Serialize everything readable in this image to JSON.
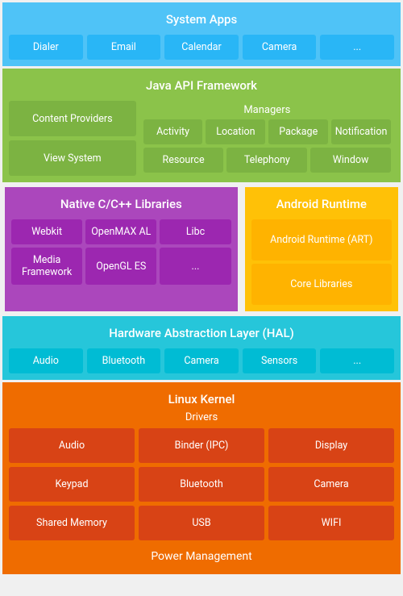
{
  "system_apps": {
    "title": "System Apps",
    "tiles": [
      "Dialer",
      "Email",
      "Calendar",
      "Camera",
      "..."
    ]
  },
  "java_api": {
    "title": "Java API Framework",
    "left": {
      "tiles": [
        "Content Providers",
        "View System"
      ]
    },
    "managers_title": "Managers",
    "managers_top": [
      "Activity",
      "Location",
      "Package",
      "Notification"
    ],
    "managers_bottom": [
      "Resource",
      "Telephony",
      "Window"
    ]
  },
  "native_cpp": {
    "title": "Native C/C++ Libraries",
    "top_tiles": [
      "Webkit",
      "OpenMAX AL",
      "Libc"
    ],
    "bottom_tiles": [
      "Media Framework",
      "OpenGL ES",
      "..."
    ]
  },
  "android_runtime": {
    "title": "Android Runtime",
    "tiles": [
      "Android Runtime (ART)",
      "Core Libraries"
    ]
  },
  "hal": {
    "title": "Hardware Abstraction Layer (HAL)",
    "tiles": [
      "Audio",
      "Bluetooth",
      "Camera",
      "Sensors",
      "..."
    ]
  },
  "linux_kernel": {
    "title": "Linux Kernel",
    "drivers_title": "Drivers",
    "tiles": [
      "Audio",
      "Binder (IPC)",
      "Display",
      "Keypad",
      "Bluetooth",
      "Camera",
      "Shared Memory",
      "USB",
      "WIFI"
    ],
    "power_management": "Power Management"
  }
}
